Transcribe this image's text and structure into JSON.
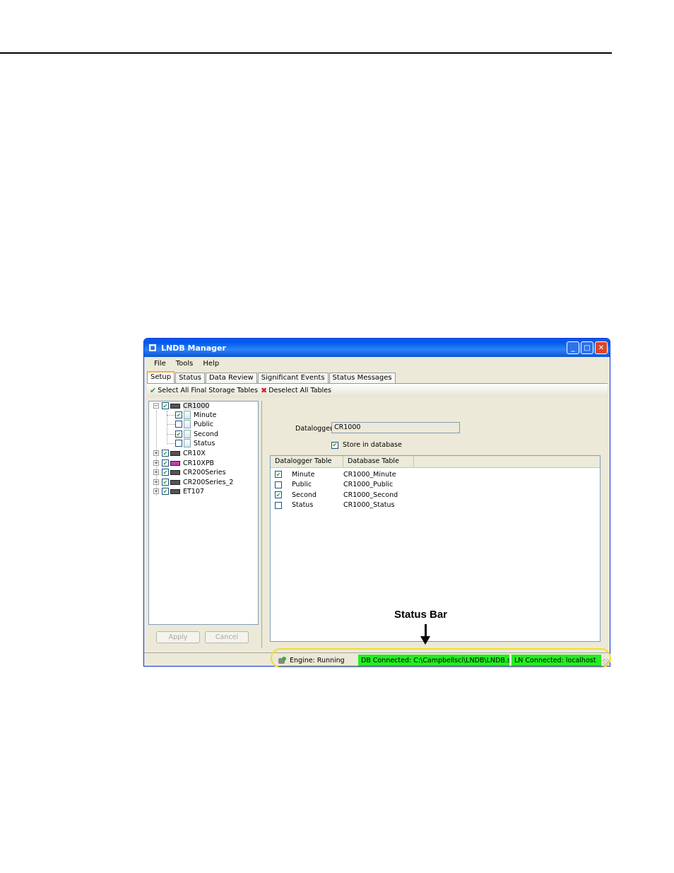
{
  "window": {
    "title": "LNDB Manager"
  },
  "menu": [
    "File",
    "Tools",
    "Help"
  ],
  "tabs": [
    "Setup",
    "Status",
    "Data Review",
    "Significant Events",
    "Status Messages"
  ],
  "toolbar": {
    "select_all": "Select All Final Storage Tables",
    "deselect_all": "Deselect All Tables"
  },
  "tree": {
    "root": "CR1000",
    "tables": [
      {
        "label": "Minute",
        "checked": true
      },
      {
        "label": "Public",
        "checked": false
      },
      {
        "label": "Second",
        "checked": true
      },
      {
        "label": "Status",
        "checked": false
      }
    ],
    "stations": [
      "CR10X",
      "CR10XPB",
      "CR200Series",
      "CR200Series_2",
      "ET107"
    ]
  },
  "buttons": {
    "apply": "Apply",
    "cancel": "Cancel"
  },
  "detail": {
    "datalogger_label": "Datalogger",
    "datalogger_value": "CR1000",
    "store_label": "Store in database",
    "col_datalogger": "Datalogger Table",
    "col_database": "Database Table",
    "rows": [
      {
        "table": "Minute",
        "db": "CR1000_Minute",
        "checked": true
      },
      {
        "table": "Public",
        "db": "CR1000_Public",
        "checked": false
      },
      {
        "table": "Second",
        "db": "CR1000_Second",
        "checked": true
      },
      {
        "table": "Status",
        "db": "CR1000_Status",
        "checked": false
      }
    ]
  },
  "status": {
    "engine": "Engine: Running",
    "db": "DB Connected: C:\\Campbellsci\\LNDB\\LNDB.sdf",
    "ln": "LN Connected: localhost"
  },
  "annotation": {
    "label": "Status Bar"
  },
  "colors": {
    "status_ok": "#22ee22",
    "callout": "#ece030",
    "titlebar": "#0058ee"
  }
}
